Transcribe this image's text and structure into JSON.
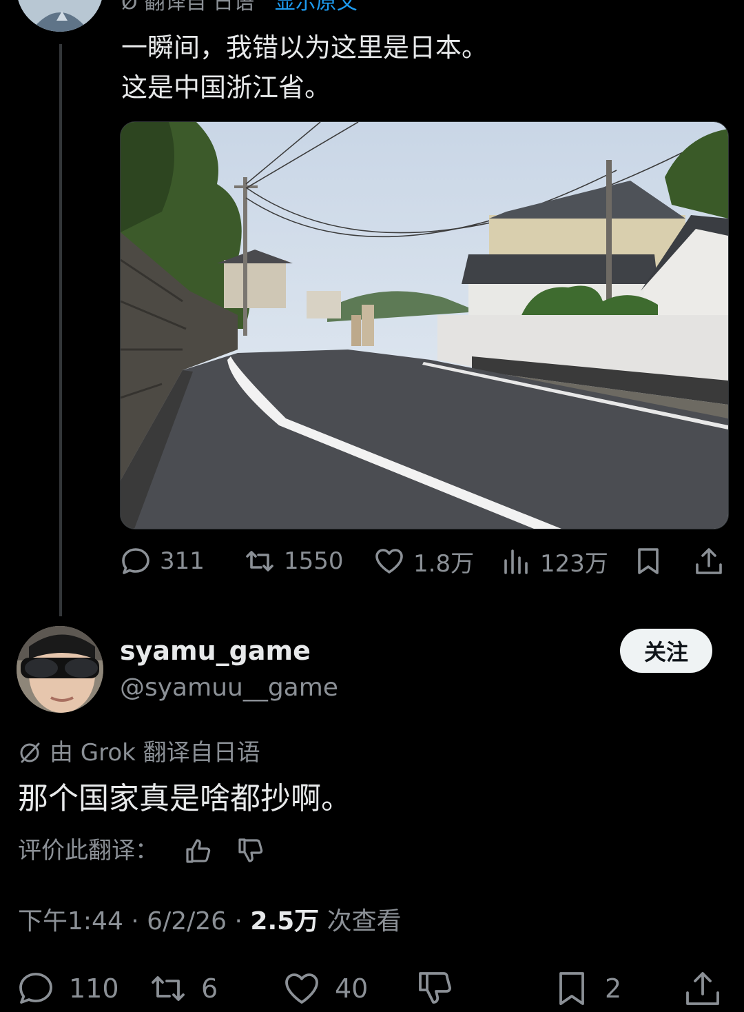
{
  "parent_tweet": {
    "translation_header": {
      "label": "翻译自 日语",
      "show_original": "显示原文"
    },
    "text_lines": [
      "一瞬间，我错以为这里是日本。",
      "这是中国浙江省。"
    ],
    "actions": {
      "replies": "311",
      "retweets": "1550",
      "likes": "1.8万",
      "views": "123万"
    }
  },
  "reply": {
    "display_name": "syamu_game",
    "handle": "@syamuu__game",
    "follow_label": "关注",
    "grok_translation": "由 Grok 翻译自日语",
    "text": "那个国家真是啥都抄啊。",
    "rate_translation": "评价此翻译：",
    "meta": {
      "time_date": "下午1:44 · 6/2/26 · ",
      "views_count": "2.5万",
      "views_label": " 次查看"
    },
    "actions": {
      "replies": "110",
      "retweets": "6",
      "likes": "40",
      "bookmarks": "2"
    }
  },
  "icons": [
    "reply-icon",
    "retweet-icon",
    "like-icon",
    "views-icon",
    "bookmark-icon",
    "share-icon",
    "translate-icon",
    "thumbs-up-icon",
    "thumbs-down-icon"
  ],
  "colors": {
    "background": "#000000",
    "text": "#e7e9ea",
    "muted": "#8b9096",
    "link": "#1d9bf0",
    "follow_button": "#eff3f4"
  }
}
